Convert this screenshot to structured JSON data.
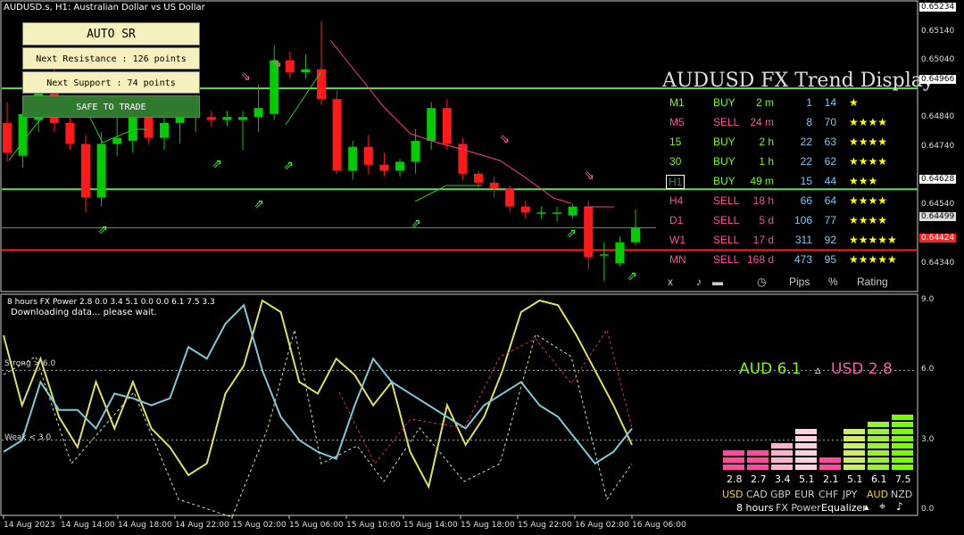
{
  "window": {
    "title": "AUDUSD.s, H1:  Australian Dollar vs US Dollar"
  },
  "colors": {
    "background": "#000000",
    "bull": "#00cc00",
    "bear": "#ff1a1a",
    "resistance_line": "#66dd55",
    "support_line": "#66dd55",
    "current_line": "#888888",
    "alert_line": "#ff2020",
    "aud": "#e0e060",
    "usd": "#7ec8d8",
    "buy": "#7cfc00",
    "sell": "#ff4aa0",
    "star": "#ffff00"
  },
  "auto_sr": {
    "title": "AUTO SR",
    "next_resistance": "Next Resistance : 126 points",
    "next_support": "Next Support : 74 points",
    "status": "SAFE TO TRADE"
  },
  "price_axis": {
    "labels": [
      "0.65234",
      "0.65140",
      "0.65040",
      "0.64966",
      "0.64840",
      "0.64740",
      "0.64628",
      "0.64540",
      "0.64499",
      "0.64424",
      "0.64340"
    ],
    "highlighted": {
      "0.65234": "#ffffff",
      "0.64966": "#ffffff",
      "0.64628": "#ffffff",
      "0.64499": "#dddddd",
      "0.64424": "#ff2020"
    }
  },
  "trend_display": {
    "title": "AUDUSD FX Trend Display",
    "rows": [
      {
        "tf": "M1",
        "signal": "BUY",
        "age": "2 m",
        "pips": "1",
        "pct": "14",
        "stars": "★"
      },
      {
        "tf": "M5",
        "signal": "SELL",
        "age": "24 m",
        "pips": "8",
        "pct": "70",
        "stars": "★★★★"
      },
      {
        "tf": "15",
        "signal": "BUY",
        "age": "2 h",
        "pips": "22",
        "pct": "63",
        "stars": "★★★★"
      },
      {
        "tf": "30",
        "signal": "BUY",
        "age": "1 h",
        "pips": "22",
        "pct": "62",
        "stars": "★★★★"
      },
      {
        "tf": "H1",
        "signal": "BUY",
        "age": "49 m",
        "pips": "15",
        "pct": "44",
        "stars": "★★★"
      },
      {
        "tf": "H4",
        "signal": "SELL",
        "age": "18 h",
        "pips": "66",
        "pct": "64",
        "stars": "★★★★"
      },
      {
        "tf": "D1",
        "signal": "SELL",
        "age": "5 d",
        "pips": "106",
        "pct": "77",
        "stars": "★★★★"
      },
      {
        "tf": "W1",
        "signal": "SELL",
        "age": "17 d",
        "pips": "311",
        "pct": "92",
        "stars": "★★★★★"
      },
      {
        "tf": "MN",
        "signal": "SELL",
        "age": "168 d",
        "pips": "473",
        "pct": "95",
        "stars": "★★★★★"
      }
    ],
    "footer": {
      "close": "x",
      "sound": "♪",
      "pips_label": "Pips",
      "pct_label": "%",
      "rating_label": "Rating"
    }
  },
  "indicator": {
    "title": "8 hours FX Power 2.8 0.0 3.4 5.1 0.0 0.0 6.1 7.5 3.3",
    "message": "Downloading data... please wait.",
    "strong_label": "Strong > 6.0",
    "weak_label": "Weak < 3.0",
    "axis_labels": [
      "9.0",
      "6.0",
      "3.0",
      "0.0"
    ],
    "aud_text": "AUD 6.1",
    "arrow": "▵",
    "usd_text": "USD 2.8"
  },
  "equalizer": {
    "values": [
      "2.8",
      "2.7",
      "3.4",
      "5.1",
      "2.1",
      "5.1",
      "6.1",
      "7.5"
    ],
    "currencies": [
      "USD",
      "CAD",
      "GBP",
      "EUR",
      "CHF",
      "JPY",
      "AUD",
      "NZD"
    ],
    "footer": {
      "period": "8 hours",
      "name": "FX Power",
      "mode": "Equalizer"
    }
  },
  "time_axis": {
    "labels": [
      "14 Aug 2023",
      "14 Aug 14:00",
      "14 Aug 18:00",
      "14 Aug 22:00",
      "15 Aug 02:00",
      "15 Aug 06:00",
      "15 Aug 10:00",
      "15 Aug 14:00",
      "15 Aug 18:00",
      "15 Aug 22:00",
      "16 Aug 02:00",
      "16 Aug 06:00"
    ]
  },
  "chart_data": [
    {
      "type": "candlestick",
      "title": "AUDUSD.s, H1: Australian Dollar vs US Dollar",
      "yaxis_range": [
        0.643,
        0.6525
      ],
      "candles": [
        {
          "o": 0.6485,
          "h": 0.6492,
          "l": 0.6472,
          "c": 0.6475
        },
        {
          "o": 0.6474,
          "h": 0.649,
          "l": 0.647,
          "c": 0.6488
        },
        {
          "o": 0.6486,
          "h": 0.6499,
          "l": 0.6482,
          "c": 0.6496
        },
        {
          "o": 0.6495,
          "h": 0.6505,
          "l": 0.6482,
          "c": 0.6485
        },
        {
          "o": 0.6485,
          "h": 0.649,
          "l": 0.6476,
          "c": 0.6478
        },
        {
          "o": 0.6478,
          "h": 0.6481,
          "l": 0.6455,
          "c": 0.646
        },
        {
          "o": 0.646,
          "h": 0.6482,
          "l": 0.6457,
          "c": 0.6478
        },
        {
          "o": 0.6478,
          "h": 0.6489,
          "l": 0.6474,
          "c": 0.648
        },
        {
          "o": 0.6479,
          "h": 0.6491,
          "l": 0.6475,
          "c": 0.6489
        },
        {
          "o": 0.649,
          "h": 0.6492,
          "l": 0.6478,
          "c": 0.648
        },
        {
          "o": 0.648,
          "h": 0.6488,
          "l": 0.6476,
          "c": 0.6485
        },
        {
          "o": 0.6485,
          "h": 0.6488,
          "l": 0.6478,
          "c": 0.6487
        },
        {
          "o": 0.6487,
          "h": 0.649,
          "l": 0.6482,
          "c": 0.6489
        },
        {
          "o": 0.6487,
          "h": 0.6489,
          "l": 0.6484,
          "c": 0.6486
        },
        {
          "o": 0.6486,
          "h": 0.6489,
          "l": 0.6484,
          "c": 0.6487
        },
        {
          "o": 0.6486,
          "h": 0.6489,
          "l": 0.6476,
          "c": 0.6487
        },
        {
          "o": 0.6487,
          "h": 0.6498,
          "l": 0.6482,
          "c": 0.649
        },
        {
          "o": 0.6488,
          "h": 0.6511,
          "l": 0.6486,
          "c": 0.6506
        },
        {
          "o": 0.6506,
          "h": 0.6509,
          "l": 0.65,
          "c": 0.6502
        },
        {
          "o": 0.6502,
          "h": 0.6508,
          "l": 0.65,
          "c": 0.6503
        },
        {
          "o": 0.6503,
          "h": 0.6519,
          "l": 0.6491,
          "c": 0.6493
        },
        {
          "o": 0.6493,
          "h": 0.6496,
          "l": 0.6468,
          "c": 0.6469
        },
        {
          "o": 0.6469,
          "h": 0.6479,
          "l": 0.6466,
          "c": 0.6477
        },
        {
          "o": 0.6477,
          "h": 0.6481,
          "l": 0.6468,
          "c": 0.6471
        },
        {
          "o": 0.6471,
          "h": 0.6475,
          "l": 0.6467,
          "c": 0.6469
        },
        {
          "o": 0.6469,
          "h": 0.6473,
          "l": 0.6467,
          "c": 0.6472
        },
        {
          "o": 0.6472,
          "h": 0.6483,
          "l": 0.6468,
          "c": 0.6479
        },
        {
          "o": 0.6479,
          "h": 0.6492,
          "l": 0.6476,
          "c": 0.649
        },
        {
          "o": 0.649,
          "h": 0.6493,
          "l": 0.6476,
          "c": 0.6478
        },
        {
          "o": 0.6478,
          "h": 0.648,
          "l": 0.6466,
          "c": 0.6468
        },
        {
          "o": 0.6468,
          "h": 0.6469,
          "l": 0.6463,
          "c": 0.6465
        },
        {
          "o": 0.6465,
          "h": 0.6467,
          "l": 0.646,
          "c": 0.6463
        },
        {
          "o": 0.6463,
          "h": 0.6464,
          "l": 0.6455,
          "c": 0.6457
        },
        {
          "o": 0.6457,
          "h": 0.6459,
          "l": 0.6453,
          "c": 0.6455
        },
        {
          "o": 0.6455,
          "h": 0.6457,
          "l": 0.6453,
          "c": 0.6455
        },
        {
          "o": 0.6455,
          "h": 0.6457,
          "l": 0.6452,
          "c": 0.6455
        },
        {
          "o": 0.6454,
          "h": 0.6458,
          "l": 0.6453,
          "c": 0.6457
        },
        {
          "o": 0.6457,
          "h": 0.6459,
          "l": 0.6436,
          "c": 0.644
        },
        {
          "o": 0.6441,
          "h": 0.6445,
          "l": 0.6432,
          "c": 0.6441
        },
        {
          "o": 0.6438,
          "h": 0.6447,
          "l": 0.6437,
          "c": 0.6445
        },
        {
          "o": 0.6445,
          "h": 0.6456,
          "l": 0.6444,
          "c": 0.645
        }
      ]
    },
    {
      "type": "line",
      "title": "8 hours FX Power",
      "ylim": [
        0,
        9
      ],
      "series": [
        {
          "name": "AUD",
          "values": [
            7.5,
            4.5,
            6.5,
            4.0,
            2.7,
            5.5,
            3.5,
            5.5,
            3.5,
            2.7,
            1.5,
            2.0,
            5.0,
            6.2,
            9.0,
            8.5,
            5.5,
            5.0,
            6.5,
            5.8,
            4.5,
            5.5,
            2.5,
            1.0,
            4.5,
            2.8,
            4.0,
            6.0,
            8.5,
            9.0,
            8.8,
            7.5,
            6.0,
            4.5,
            2.8
          ]
        },
        {
          "name": "USD",
          "values": [
            2.5,
            3.0,
            5.5,
            4.3,
            4.3,
            3.5,
            5.0,
            4.8,
            4.5,
            4.8,
            7.0,
            6.5,
            8.0,
            8.8,
            6.0,
            4.0,
            3.0,
            2.5,
            2.2,
            4.5,
            6.5,
            5.5,
            5.0,
            4.5,
            4.0,
            3.5,
            4.5,
            5.0,
            5.5,
            4.5,
            4.0,
            3.0,
            2.0,
            2.5,
            3.5
          ]
        }
      ]
    }
  ]
}
